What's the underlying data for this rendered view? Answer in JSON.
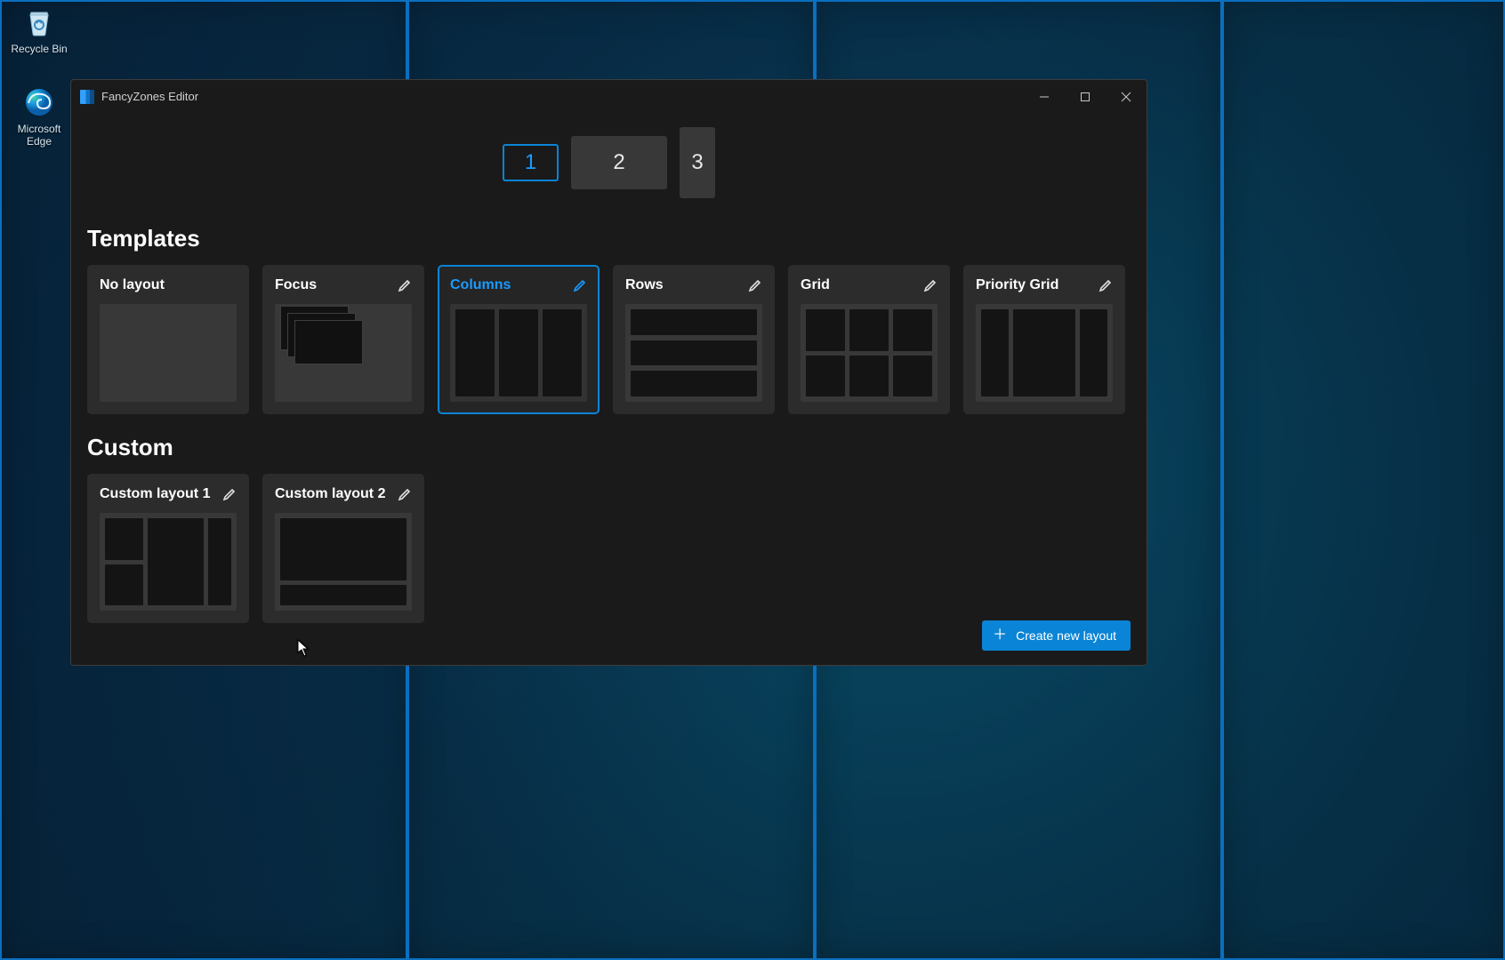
{
  "desktop": {
    "icons": [
      {
        "name": "Recycle Bin"
      },
      {
        "name": "Microsoft Edge"
      }
    ]
  },
  "window": {
    "title": "FancyZones Editor"
  },
  "monitors": {
    "items": [
      "1",
      "2",
      "3"
    ],
    "selected_index": 0
  },
  "sections": {
    "templates_title": "Templates",
    "custom_title": "Custom"
  },
  "templates": [
    {
      "name": "No layout",
      "editable": false,
      "selected": false,
      "preview": "none"
    },
    {
      "name": "Focus",
      "editable": true,
      "selected": false,
      "preview": "focus"
    },
    {
      "name": "Columns",
      "editable": true,
      "selected": true,
      "preview": "columns"
    },
    {
      "name": "Rows",
      "editable": true,
      "selected": false,
      "preview": "rows"
    },
    {
      "name": "Grid",
      "editable": true,
      "selected": false,
      "preview": "grid"
    },
    {
      "name": "Priority Grid",
      "editable": true,
      "selected": false,
      "preview": "priority"
    }
  ],
  "custom": [
    {
      "name": "Custom layout 1",
      "editable": true,
      "preview": "custom1"
    },
    {
      "name": "Custom layout 2",
      "editable": true,
      "preview": "custom2"
    }
  ],
  "buttons": {
    "create_new_layout": "Create new layout"
  },
  "colors": {
    "accent": "#0a84d6"
  }
}
